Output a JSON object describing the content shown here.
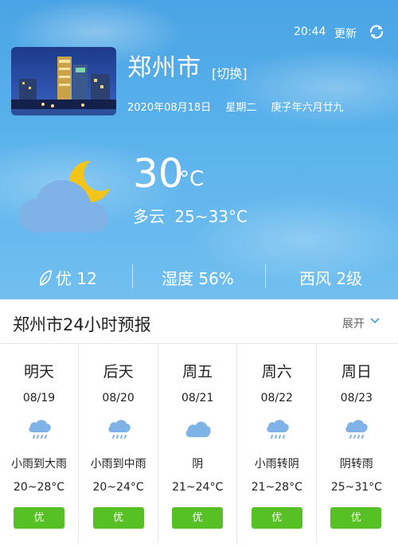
{
  "status": {
    "time": "20:44",
    "refresh_label": "更新"
  },
  "location": {
    "city": "郑州市",
    "switch_label": "[切换]",
    "date": "2020年08月18日",
    "weekday": "星期二",
    "lunar": "庚子年六月廿九"
  },
  "current": {
    "temperature": "30",
    "unit": "°C",
    "condition": "多云",
    "range": "25~33°C",
    "icon": "cloud-moon-icon"
  },
  "stats": {
    "aqi": "优 12",
    "humidity": "湿度 56%",
    "wind": "西风 2级"
  },
  "forecast": {
    "title": "郑州市24小时预报",
    "expand_label": "展开",
    "days": [
      {
        "name": "明天",
        "date": "08/19",
        "icon": "rain-icon",
        "condition": "小雨到大雨",
        "temp": "20~28°C",
        "aqi": "优"
      },
      {
        "name": "后天",
        "date": "08/20",
        "icon": "rain-icon",
        "condition": "小雨到中雨",
        "temp": "20~24°C",
        "aqi": "优"
      },
      {
        "name": "周五",
        "date": "08/21",
        "icon": "overcast-icon",
        "condition": "阴",
        "temp": "21~24°C",
        "aqi": "优"
      },
      {
        "name": "周六",
        "date": "08/22",
        "icon": "rain-icon",
        "condition": "小雨转阴",
        "temp": "21~28°C",
        "aqi": "优"
      },
      {
        "name": "周日",
        "date": "08/23",
        "icon": "rain-icon",
        "condition": "阴转雨",
        "temp": "25~31°C",
        "aqi": "优"
      }
    ]
  },
  "colors": {
    "sky": "#5ab2ec",
    "aqi_good": "#56c024",
    "cloud_icon": "#7fb3e8"
  }
}
